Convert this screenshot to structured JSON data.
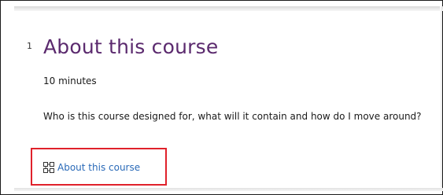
{
  "section": {
    "number": "1",
    "title": "About this course",
    "duration": "10 minutes",
    "description": "Who is this course designed for, what will it contain and how do I move around?",
    "link": {
      "label": "About this course",
      "icon": "sitemap-icon"
    }
  },
  "colors": {
    "title": "#5b2a6e",
    "link": "#2a6ab8",
    "highlight": "#e0212b"
  }
}
